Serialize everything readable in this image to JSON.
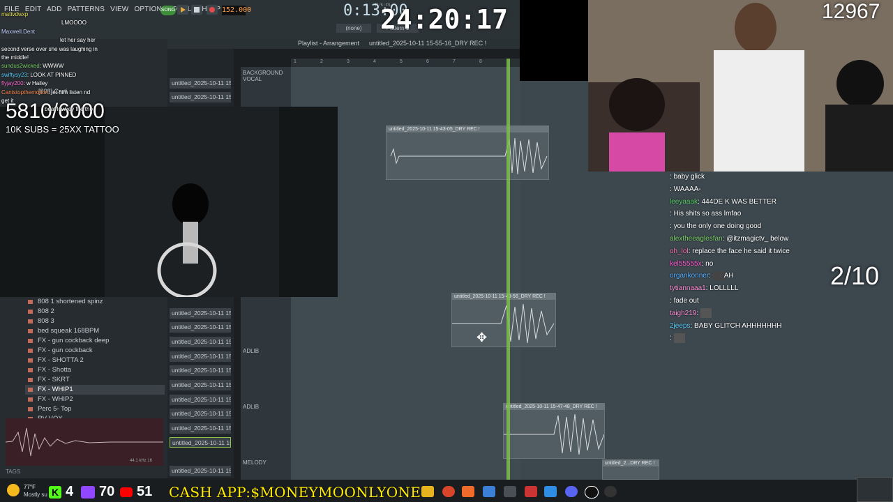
{
  "daw": {
    "menu": [
      "FILE",
      "EDIT",
      "ADD",
      "PATTERNS",
      "VIEW",
      "OPTIONS",
      "TOOLS",
      "HELP"
    ],
    "song_mode_label": "SONG",
    "tempo": "152.000",
    "song_time": "0:13:00",
    "time_unit_label": "M:S:CS",
    "pattern_select": "(none)",
    "pattern_label": "Pattern 1",
    "playlist_breadcrumb": "Playlist - Arrangement",
    "project_name": "untitled_2025-10-11 15-55-16_DRY REC !",
    "ruler_numbers": [
      "1",
      "2",
      "3",
      "4",
      "5",
      "6",
      "7",
      "8"
    ],
    "track_labels": [
      "BACKGROUND VOCAL",
      "ADLIB",
      "ADLIB",
      "MELODY"
    ],
    "clips": [
      "untitled_2025-10-11 15-43-05_DRY REC !",
      "untitled_2025-10-11 15-43-56_DRY REC !",
      "untitled_2025-10-11 15-47-48_DRY REC !",
      "untitled_2...DRY REC !"
    ],
    "browser_items": [
      "808 1 shortened spinz",
      "808 2",
      "808 3",
      "bed squeak 168BPM",
      "FX - gun cockback deep",
      "FX - gun cockback",
      "FX - SHOTTA 2",
      "FX - Shotta",
      "FX - SKRT",
      "FX - WHIP1",
      "FX - WHIP2",
      "Perc 5- Top",
      "RV VOX"
    ],
    "browser_selected": "FX - WHIP1",
    "browser_upper_items": [
      "[808] Carti"
    ],
    "channel_items": [
      "untitled_2025-10-11 15-",
      "untitled_2025-10-11 15-",
      "untitled_2025-10-11 15-",
      "untitled_2025-10-11 15-",
      "untitled_2025-10-11 15-",
      "untitled_2025-10-11 15-",
      "untitled_2025-10-11 15-",
      "untitled_2025-10-11 15-",
      "untitled_2025-10-11 15-",
      "untitled_2025-10-11 15-",
      "untitled_2025-10-11 15-",
      "untitled_2025-10-11 15-",
      "untitled_2025-10-11 15-"
    ],
    "preview_info": "44.1 kHz 16",
    "tags_label": "TAGS"
  },
  "overlay": {
    "stream_timer": "24:20:17",
    "viewer_count": "12967",
    "sub_goal": "5810/6000",
    "sub_goal_text": "10K SUBS = 25XX TATTOO",
    "counter": "2/10",
    "cash_app": "CASH APP:$MONEYMOONLYONE",
    "kick_count": "4",
    "twitch_count": "70",
    "youtube_count": "51"
  },
  "chat_left": [
    {
      "user": "mattvdwxp",
      "msg": ""
    },
    {
      "user": "",
      "msg": "LMOOOO"
    },
    {
      "user": "Maxwell.Dent",
      "msg": ""
    },
    {
      "user": "",
      "msg": "let her say her"
    },
    {
      "user": "",
      "msg": "second verse over she was laughing in"
    },
    {
      "user": "",
      "msg": "the middle!"
    },
    {
      "user": "sundus2wicked",
      "msg": "WWWW"
    },
    {
      "user": "swiftysy23",
      "msg": "LOOK AT PINNED"
    },
    {
      "user": "flyjay200",
      "msg": "w Hailey"
    },
    {
      "user": "Cantstopthemotion",
      "msg": "let him listen nd"
    },
    {
      "user": "",
      "msg": "get it"
    },
    {
      "user": "",
      "msg": "beat lowkey fire tho"
    }
  ],
  "chat_right": [
    {
      "user": "",
      "msg": "baby glick"
    },
    {
      "user": "",
      "msg": "WAAAA-"
    },
    {
      "user": "leeyaaak",
      "msg": "444DE K WAS BETTER"
    },
    {
      "user": "",
      "msg": "His shits so ass lmfao"
    },
    {
      "user": "",
      "msg": "you the only one doing good"
    },
    {
      "user": "alextheeaglesfan",
      "msg": "@itzmagictv_ below"
    },
    {
      "user": "oh_lol",
      "msg": "replace the face he said it twice"
    },
    {
      "user": "kel55555x",
      "msg": "no"
    },
    {
      "user": "organkonner",
      "msg": "AH"
    },
    {
      "user": "tytiannaaa1",
      "msg": "LOLLLLL"
    },
    {
      "user": "",
      "msg": "fade out"
    },
    {
      "user": "taigh219",
      "msg": ""
    },
    {
      "user": "2jeeps",
      "msg": "BABY GLITCH AHHHHHHH"
    },
    {
      "user": "",
      "msg": ""
    }
  ],
  "taskbar": {
    "weather_temp": "77°F",
    "weather_desc": "Mostly su"
  },
  "colors": {
    "playhead": "#7cc04a",
    "cashapp": "#ffec00",
    "kick": "#53fc18",
    "twitch": "#9146ff",
    "youtube": "#ff0000"
  }
}
